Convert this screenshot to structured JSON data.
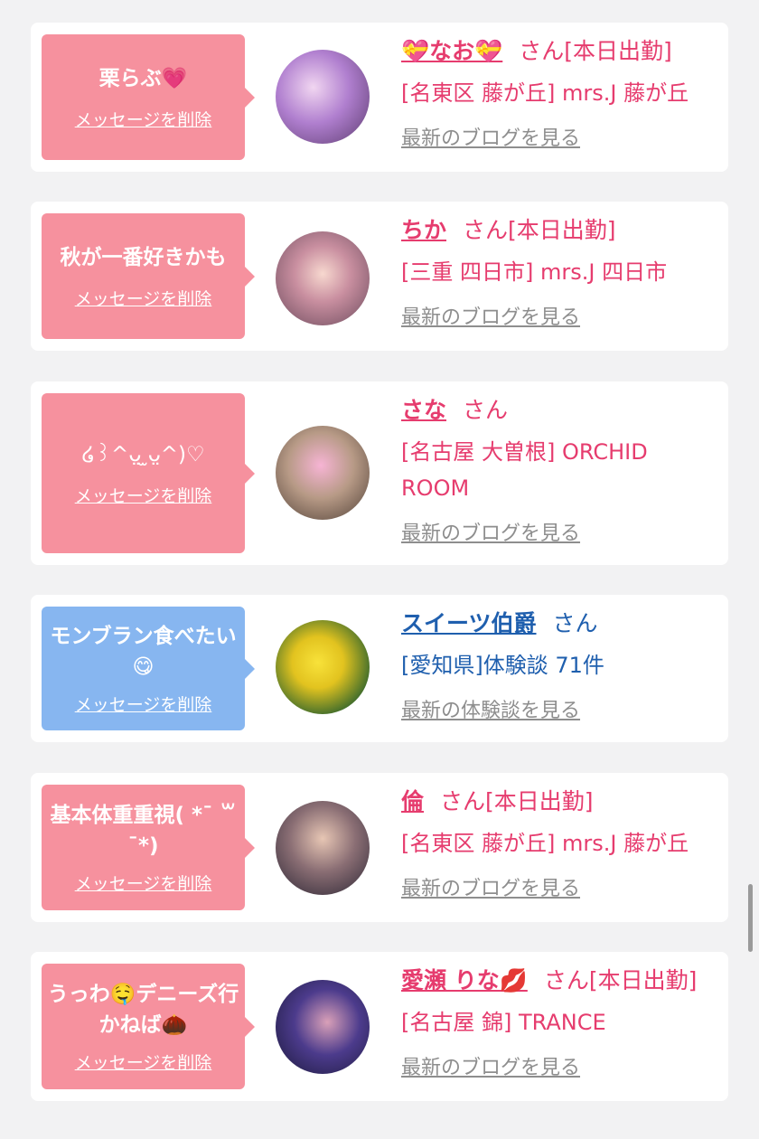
{
  "delete_label": "メッセージを削除",
  "san_label": "さん",
  "cards": [
    {
      "message": "栗らぶ💗",
      "name": "💝なお💝",
      "status": "[本日出勤]",
      "location": "[名東区 藤が丘] mrs.J 藤が丘",
      "blog_link": "最新のブログを見る",
      "theme": "pink"
    },
    {
      "message": "秋が一番好きかも",
      "name": "ちか",
      "status": "[本日出勤]",
      "location": "[三重 四日市] mrs.J 四日市",
      "blog_link": "最新のブログを見る",
      "theme": "pink"
    },
    {
      "message": "໒꒱^ᴗ̤ ̫ᴗ̤^)♡",
      "name": "さな",
      "status": "",
      "location": "[名古屋 大曽根] ORCHID ROOM",
      "blog_link": "最新のブログを見る",
      "theme": "pink"
    },
    {
      "message": "モンブラン食べたい😋",
      "name": "スイーツ伯爵",
      "status": "",
      "location": "[愛知県]体験談 71件",
      "blog_link": "最新の体験談を見る",
      "theme": "blue"
    },
    {
      "message": "基本体重重視( *¯ ꒳¯*)",
      "name": "倫",
      "status": "[本日出勤]",
      "location": "[名東区 藤が丘] mrs.J 藤が丘",
      "blog_link": "最新のブログを見る",
      "theme": "pink"
    },
    {
      "message": "うっわ🤤デニーズ行かねば🌰",
      "name": "愛瀬 りな💋",
      "status": "[本日出勤]",
      "location": "[名古屋 錦] TRANCE",
      "blog_link": "最新のブログを見る",
      "theme": "pink"
    }
  ]
}
